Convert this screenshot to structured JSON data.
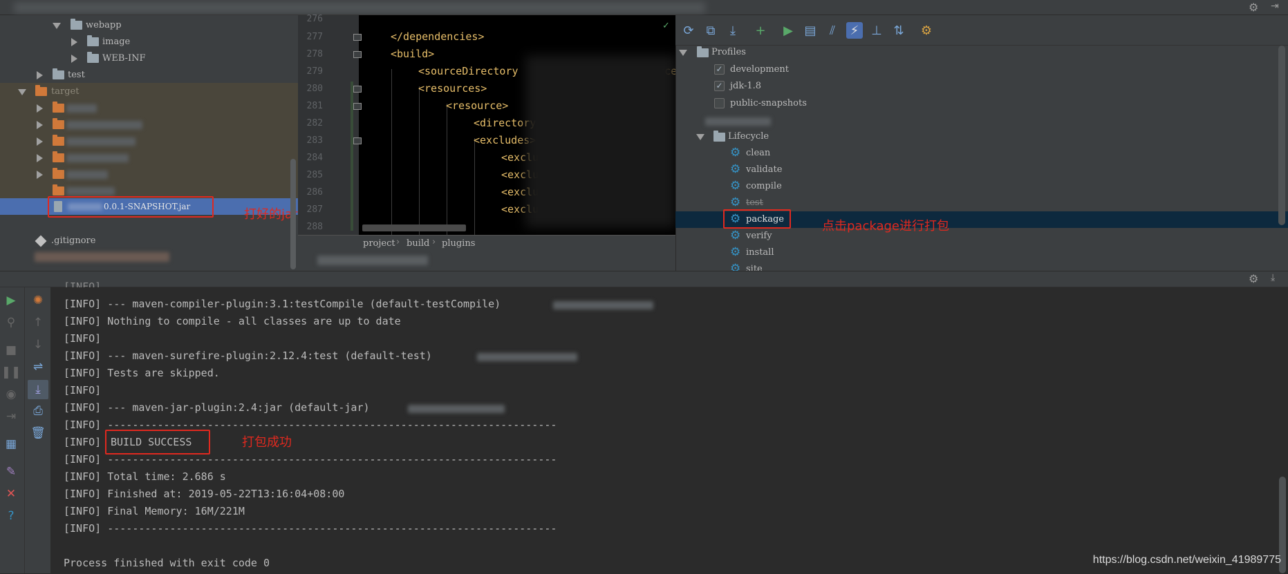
{
  "project_tree": {
    "items": [
      {
        "label": "webapp",
        "icon": "folder-icon"
      },
      {
        "label": "image",
        "icon": "folder-icon"
      },
      {
        "label": "WEB-INF",
        "icon": "folder-icon"
      },
      {
        "label": "test",
        "icon": "folder-icon"
      },
      {
        "label": "target",
        "icon": "folder-icon"
      }
    ],
    "jar_label": "0.0.1-SNAPSHOT.jar",
    "gitignore_label": ".gitignore",
    "annotation": "打好的jar包"
  },
  "editor": {
    "line_numbers": [
      "276",
      "277",
      "278",
      "279",
      "280",
      "281",
      "282",
      "283",
      "284",
      "285",
      "286",
      "287",
      "288"
    ],
    "lines": [
      "</dependencies>",
      "<build>",
      "<sourceDirectory",
      "<resources>",
      "<resource>",
      "<directory",
      "<excludes>",
      "<exclude",
      "<exclude",
      "<exclude>",
      "<exclude>"
    ],
    "partial_text": "ource",
    "breadcrumb": [
      "project",
      "build",
      "plugins"
    ]
  },
  "maven": {
    "profiles_label": "Profiles",
    "profiles": [
      {
        "label": "development",
        "checked": true
      },
      {
        "label": "jdk-1.8",
        "checked": true
      },
      {
        "label": "public-snapshots",
        "checked": false
      }
    ],
    "lifecycle_label": "Lifecycle",
    "lifecycle": [
      "clean",
      "validate",
      "compile",
      "test",
      "package",
      "verify",
      "install",
      "site"
    ],
    "annotation": "点击package进行打包"
  },
  "console": {
    "lines": [
      "[INFO] --- maven-compiler-plugin:3.1:testCompile (default-testCompile)",
      "[INFO] Nothing to compile - all classes are up to date",
      "[INFO]",
      "[INFO] --- maven-surefire-plugin:2.12.4:test (default-test)",
      "[INFO] Tests are skipped.",
      "[INFO]",
      "[INFO] --- maven-jar-plugin:2.4:jar (default-jar)",
      "[INFO] ------------------------------------------------------------------------",
      "[INFO]",
      "[INFO] ------------------------------------------------------------------------",
      "[INFO] Total time: 2.686 s",
      "[INFO] Finished at: 2019-05-22T13:16:04+08:00",
      "[INFO] Final Memory: 16M/221M",
      "[INFO] ------------------------------------------------------------------------",
      "",
      "Process finished with exit code 0"
    ],
    "build_success": "BUILD SUCCESS",
    "annotation": "打包成功"
  },
  "watermark": "https://blog.csdn.net/weixin_41989775",
  "colors": {
    "annotation": "#e0291f",
    "selection": "#4b6eaf",
    "tag": "#e8bf6a"
  }
}
